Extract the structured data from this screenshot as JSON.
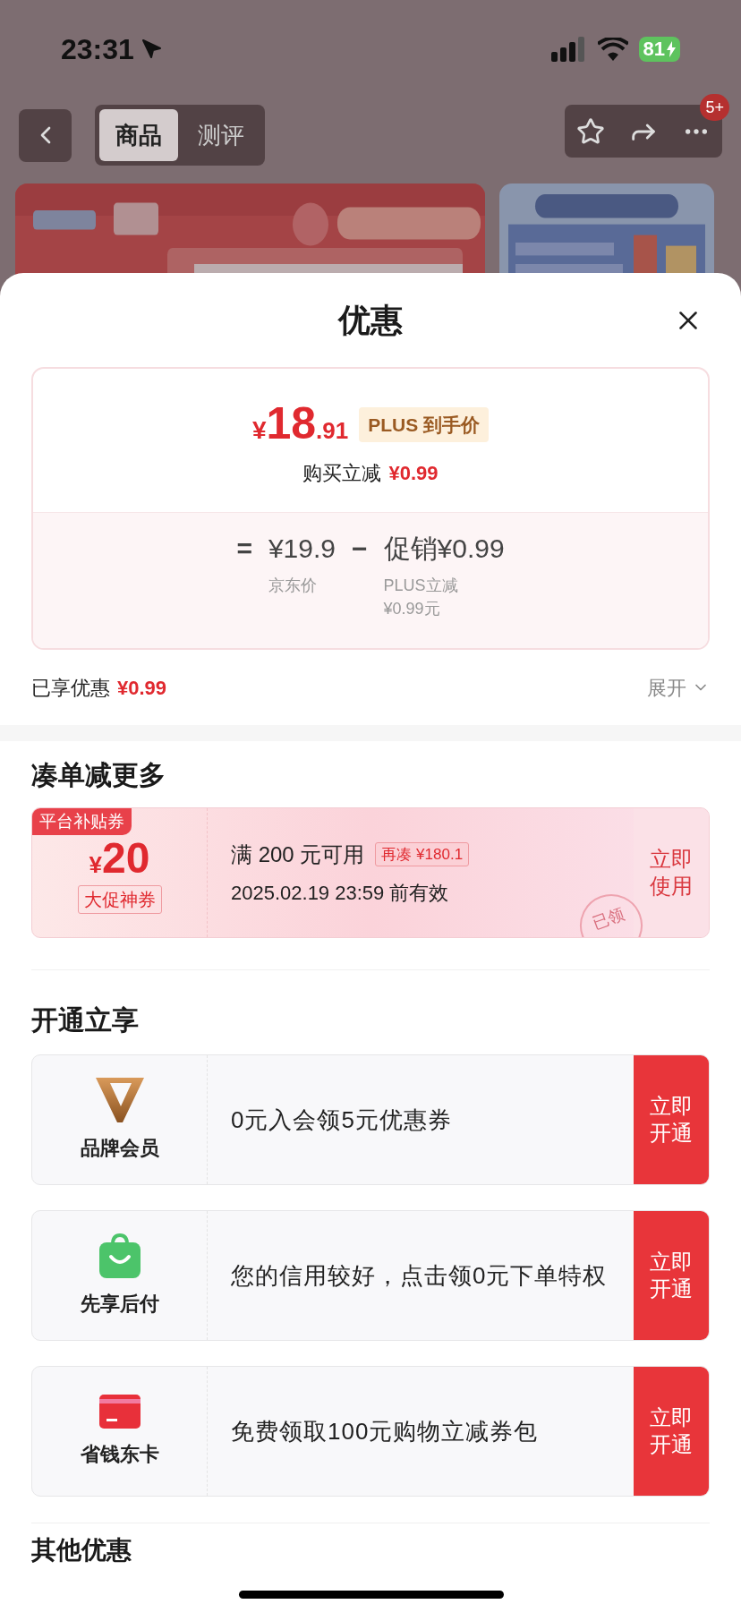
{
  "status_bar": {
    "time": "23:31",
    "battery": "81"
  },
  "nav": {
    "tabs": [
      {
        "label": "商品",
        "selected": true
      },
      {
        "label": "测评",
        "selected": false
      }
    ],
    "badge": "5+"
  },
  "sheet": {
    "title": "优惠"
  },
  "price_card": {
    "currency": "¥",
    "price_int": "18",
    "price_dec": ".91",
    "price_tag": "PLUS 到手价",
    "instant_label": "购买立减",
    "instant_amount": "¥0.99",
    "equals": "=",
    "base_price": "¥19.9",
    "minus": "−",
    "promo": "促销¥0.99",
    "base_caption": "京东价",
    "promo_caption": "PLUS立减¥0.99元"
  },
  "summary": {
    "label": "已享优惠",
    "amount": "¥0.99",
    "expand": "展开"
  },
  "bundle": {
    "heading": "凑单减更多",
    "coupon": {
      "ribbon": "平台补贴券",
      "currency": "¥",
      "amount": "20",
      "tag": "大促神券",
      "condition": "满 200 元可用",
      "extra": "再凑 ¥180.1",
      "validity": "2025.02.19 23:59 前有效",
      "stamp": "已领",
      "action": "立即使用"
    }
  },
  "open": {
    "heading": "开通立享",
    "rows": [
      {
        "kind": "brand",
        "name": "品牌会员",
        "text": "0元入会领5元优惠券",
        "action": "立即开通"
      },
      {
        "kind": "bag",
        "name": "先享后付",
        "text": "您的信用较好，点击领0元下单特权",
        "action": "立即开通"
      },
      {
        "kind": "card",
        "name": "省钱东卡",
        "text": "免费领取100元购物立减券包",
        "action": "立即开通"
      }
    ]
  },
  "other": {
    "heading": "其他优惠"
  }
}
